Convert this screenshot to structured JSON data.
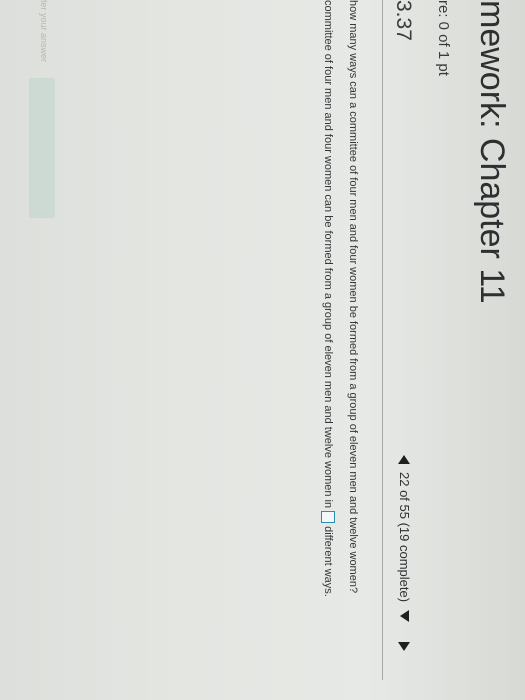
{
  "header": {
    "title": "mework: Chapter 11",
    "score": "re: 0 of 1 pt",
    "question_number": "3.37"
  },
  "nav": {
    "progress": "22 of 55 (19 complete)"
  },
  "question": {
    "text": "how many ways can a committee of four men and four women be formed from a group of eleven men and twelve women?",
    "answer_prefix": "committee of four men and four women can be formed from a group of eleven men and twelve women in",
    "answer_suffix": "different ways."
  },
  "footer": {
    "hint": "ter your answer"
  }
}
